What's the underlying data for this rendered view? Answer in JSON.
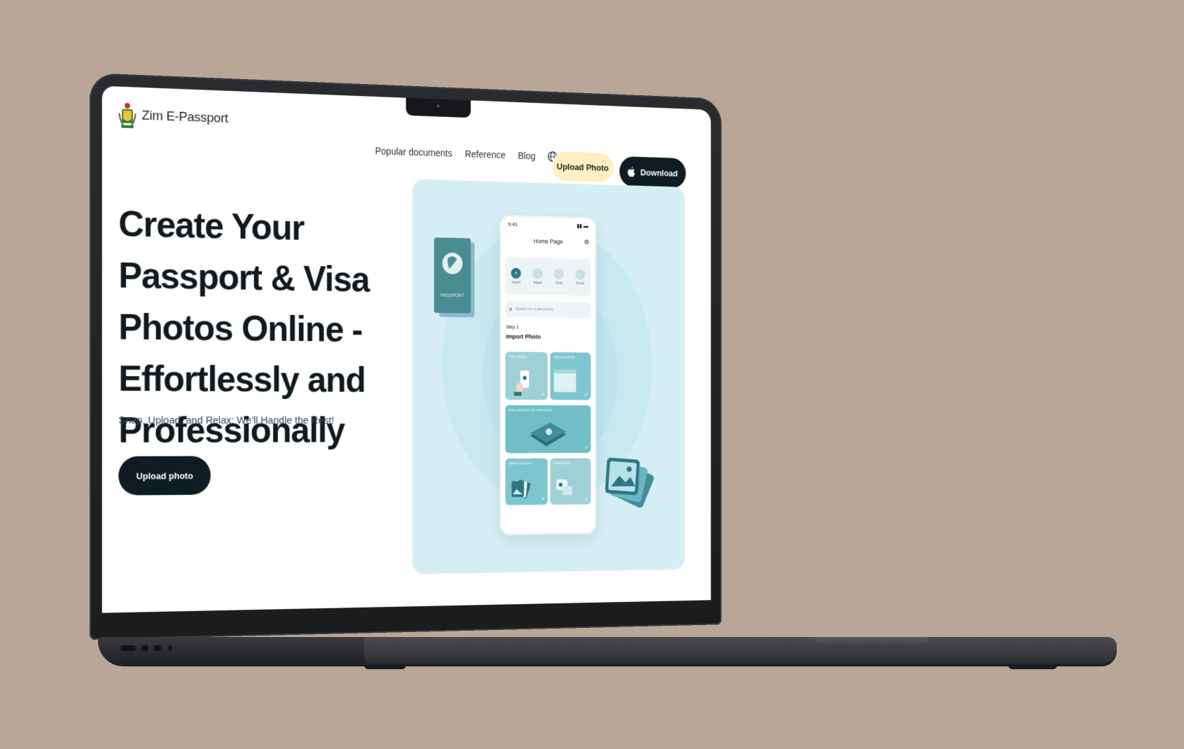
{
  "site": {
    "brand": "Zim E-Passport",
    "nav": {
      "items": [
        "Popular documents",
        "Reference",
        "Blog"
      ],
      "upload_label": "Upload Photo",
      "download_label": "Download"
    },
    "hero": {
      "title": "Create Your Passport & Visa Photos Online - Effortlessly and Professionally",
      "subtitle": "Snap, Upload, and Relax: We'll Handle the Rest!",
      "cta_label": "Upload photo"
    },
    "phone": {
      "time": "9:41",
      "title": "Home Page",
      "steps": [
        "Import",
        "Adjust",
        "Crop",
        "Finish"
      ],
      "search_placeholder": "Search for a document",
      "step_label": "Step 1",
      "step_title": "Import Photo",
      "cards": {
        "take": "Take photo",
        "upload": "Upload photo",
        "reference": "Get passport for reference",
        "saved": "Saved photos",
        "feedback": "Feedback"
      },
      "passport_word": "PASSPORT"
    }
  },
  "colors": {
    "background": "#b8a797",
    "dark": "#0f1d23",
    "upload_pill": "#fdf0c2",
    "showcase": "#d5eef3",
    "teal": "#7ec6cf",
    "teal_dark": "#2b7a86"
  },
  "icons": [
    "coat-of-arms-icon",
    "globe-icon",
    "apple-icon",
    "search-icon",
    "gear-icon",
    "passport-icon",
    "photo-stack-icon",
    "arrow-icon"
  ]
}
